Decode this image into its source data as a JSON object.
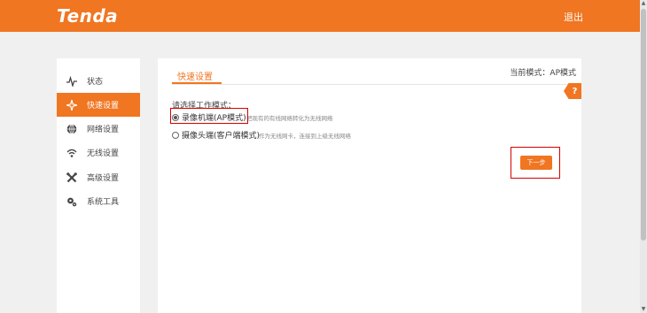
{
  "header": {
    "logo_text": "Tenda",
    "logout_label": "退出",
    "brand_color": "#f07622"
  },
  "sidebar": {
    "items": [
      {
        "label": "状态",
        "icon": "pulse-icon",
        "active": false
      },
      {
        "label": "快速设置",
        "icon": "wizard-icon",
        "active": true
      },
      {
        "label": "网络设置",
        "icon": "globe-icon",
        "active": false
      },
      {
        "label": "无线设置",
        "icon": "wifi-icon",
        "active": false
      },
      {
        "label": "高级设置",
        "icon": "tools-icon",
        "active": false
      },
      {
        "label": "系统工具",
        "icon": "gears-icon",
        "active": false
      }
    ]
  },
  "main": {
    "tab_label": "快速设置",
    "current_mode": "当前模式：AP模式",
    "help_label": "?",
    "prompt": "请选择工作模式：",
    "options": [
      {
        "label": "录像机端(AP模式)",
        "description": "把现有的有线网络转化为无线网络",
        "selected": true
      },
      {
        "label": "摄像头端(客户端模式)",
        "description": "作为无线网卡，连接到上级无线网络",
        "selected": false
      }
    ],
    "next_label": "下一步"
  }
}
